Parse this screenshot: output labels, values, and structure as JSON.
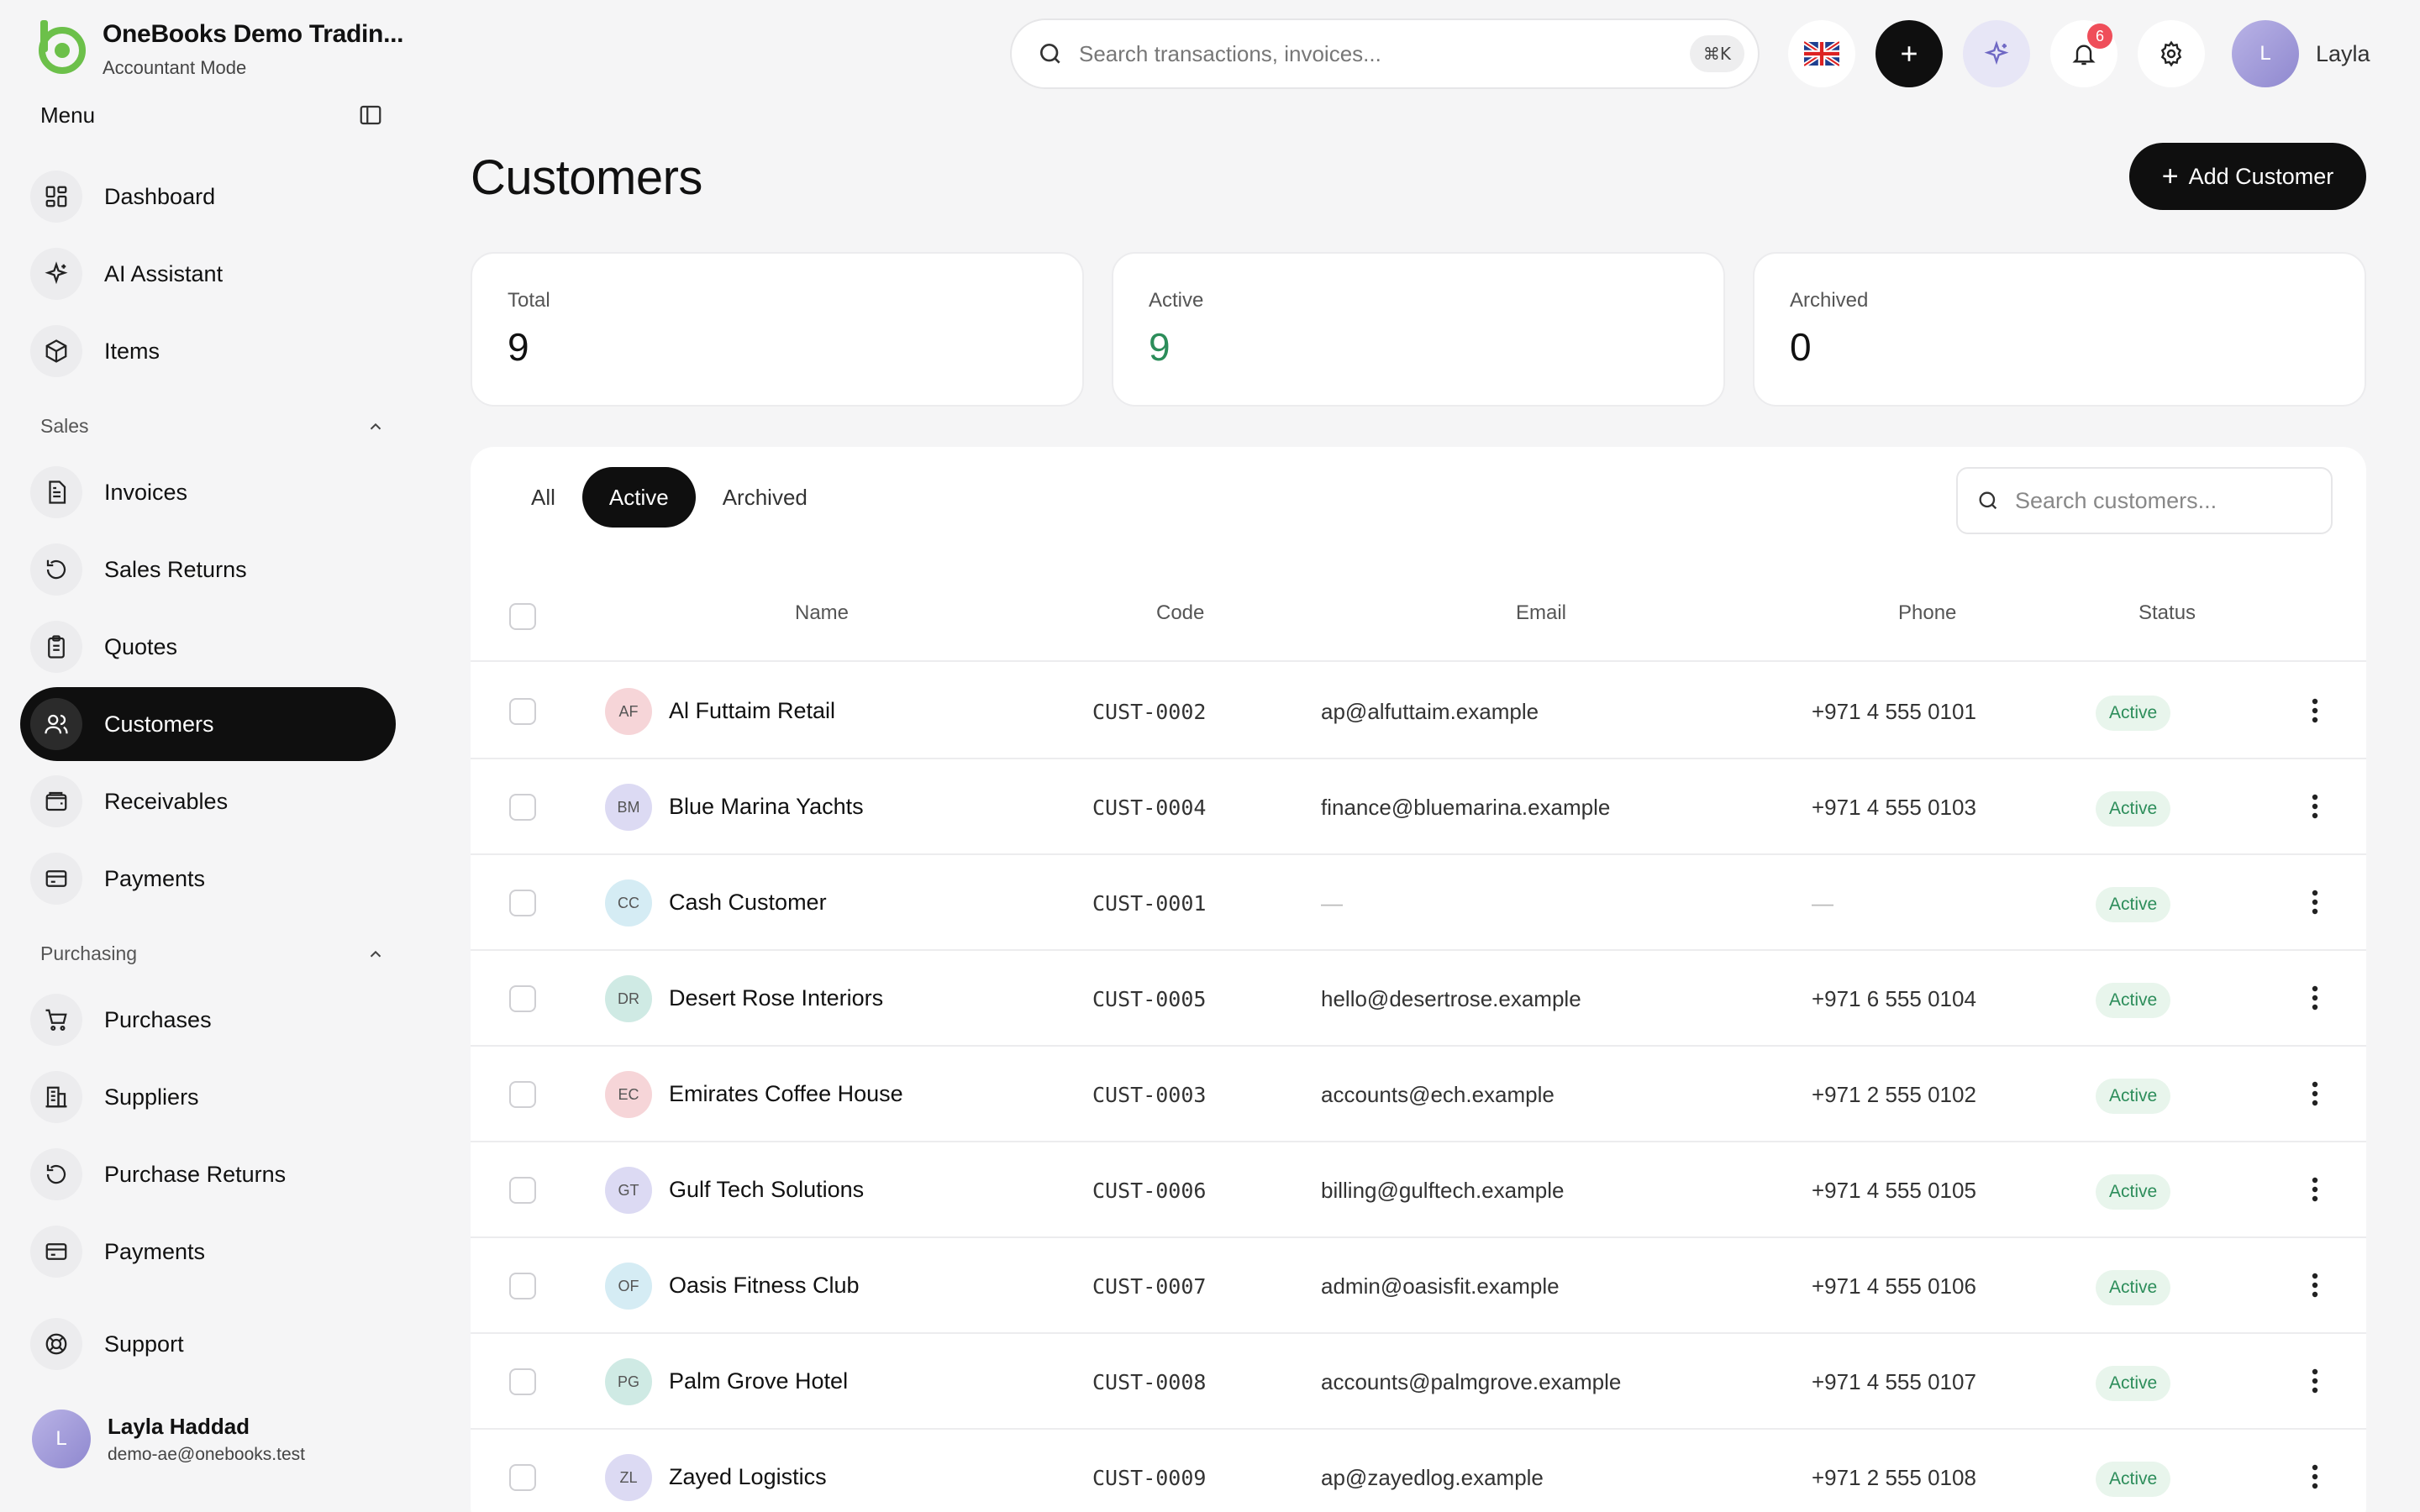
{
  "brand": {
    "name": "OneBooks Demo Tradin...",
    "mode": "Accountant Mode",
    "logo_color": "#6cc04a"
  },
  "sidebar": {
    "menu_title": "Menu",
    "top_items": [
      {
        "label": "Dashboard",
        "icon": "dashboard-icon"
      },
      {
        "label": "AI Assistant",
        "icon": "sparkle-icon"
      },
      {
        "label": "Items",
        "icon": "box-icon"
      }
    ],
    "sales_section": "Sales",
    "sales_items": [
      {
        "label": "Invoices",
        "icon": "invoice-icon"
      },
      {
        "label": "Sales Returns",
        "icon": "return-icon"
      },
      {
        "label": "Quotes",
        "icon": "clipboard-icon"
      },
      {
        "label": "Customers",
        "icon": "users-icon",
        "active": true
      },
      {
        "label": "Receivables",
        "icon": "wallet-icon"
      },
      {
        "label": "Payments",
        "icon": "card-icon"
      }
    ],
    "purchasing_section": "Purchasing",
    "purchasing_items": [
      {
        "label": "Purchases",
        "icon": "cart-icon"
      },
      {
        "label": "Suppliers",
        "icon": "building-icon"
      },
      {
        "label": "Purchase Returns",
        "icon": "return-icon"
      },
      {
        "label": "Payments",
        "icon": "card-icon"
      }
    ],
    "support": {
      "label": "Support",
      "icon": "lifebuoy-icon"
    },
    "user": {
      "initial": "L",
      "name": "Layla Haddad",
      "email": "demo-ae@onebooks.test"
    }
  },
  "topbar": {
    "search_placeholder": "Search transactions, invoices...",
    "shortcut": "⌘K",
    "notifications_count": "6",
    "user_initial": "L",
    "user_name": "Layla"
  },
  "page": {
    "title": "Customers",
    "add_button": "Add Customer"
  },
  "stats": [
    {
      "label": "Total",
      "value": "9"
    },
    {
      "label": "Active",
      "value": "9"
    },
    {
      "label": "Archived",
      "value": "0"
    }
  ],
  "tabs": [
    {
      "label": "All"
    },
    {
      "label": "Active",
      "active": true
    },
    {
      "label": "Archived"
    }
  ],
  "table_search_placeholder": "Search customers...",
  "columns": {
    "name": "Name",
    "code": "Code",
    "email": "Email",
    "phone": "Phone",
    "status": "Status"
  },
  "customers": [
    {
      "initials": "AF",
      "name": "Al Futtaim Retail",
      "code": "CUST-0002",
      "email": "ap@alfuttaim.example",
      "phone": "+971 4 555 0101",
      "status": "Active",
      "avatar_bg": "#f6d5d8"
    },
    {
      "initials": "BM",
      "name": "Blue Marina Yachts",
      "code": "CUST-0004",
      "email": "finance@bluemarina.example",
      "phone": "+971 4 555 0103",
      "status": "Active",
      "avatar_bg": "#dcdaf3"
    },
    {
      "initials": "CC",
      "name": "Cash Customer",
      "code": "CUST-0001",
      "email": "—",
      "phone": "—",
      "status": "Active",
      "avatar_bg": "#d5ecf4"
    },
    {
      "initials": "DR",
      "name": "Desert Rose Interiors",
      "code": "CUST-0005",
      "email": "hello@desertrose.example",
      "phone": "+971 6 555 0104",
      "status": "Active",
      "avatar_bg": "#cfeae4"
    },
    {
      "initials": "EC",
      "name": "Emirates Coffee House",
      "code": "CUST-0003",
      "email": "accounts@ech.example",
      "phone": "+971 2 555 0102",
      "status": "Active",
      "avatar_bg": "#f6d5d8"
    },
    {
      "initials": "GT",
      "name": "Gulf Tech Solutions",
      "code": "CUST-0006",
      "email": "billing@gulftech.example",
      "phone": "+971 4 555 0105",
      "status": "Active",
      "avatar_bg": "#dcdaf3"
    },
    {
      "initials": "OF",
      "name": "Oasis Fitness Club",
      "code": "CUST-0007",
      "email": "admin@oasisfit.example",
      "phone": "+971 4 555 0106",
      "status": "Active",
      "avatar_bg": "#d5ecf4"
    },
    {
      "initials": "PG",
      "name": "Palm Grove Hotel",
      "code": "CUST-0008",
      "email": "accounts@palmgrove.example",
      "phone": "+971 4 555 0107",
      "status": "Active",
      "avatar_bg": "#cfeae4"
    },
    {
      "initials": "ZL",
      "name": "Zayed Logistics",
      "code": "CUST-0009",
      "email": "ap@zayedlog.example",
      "phone": "+971 2 555 0108",
      "status": "Active",
      "avatar_bg": "#dcdaf3"
    }
  ]
}
